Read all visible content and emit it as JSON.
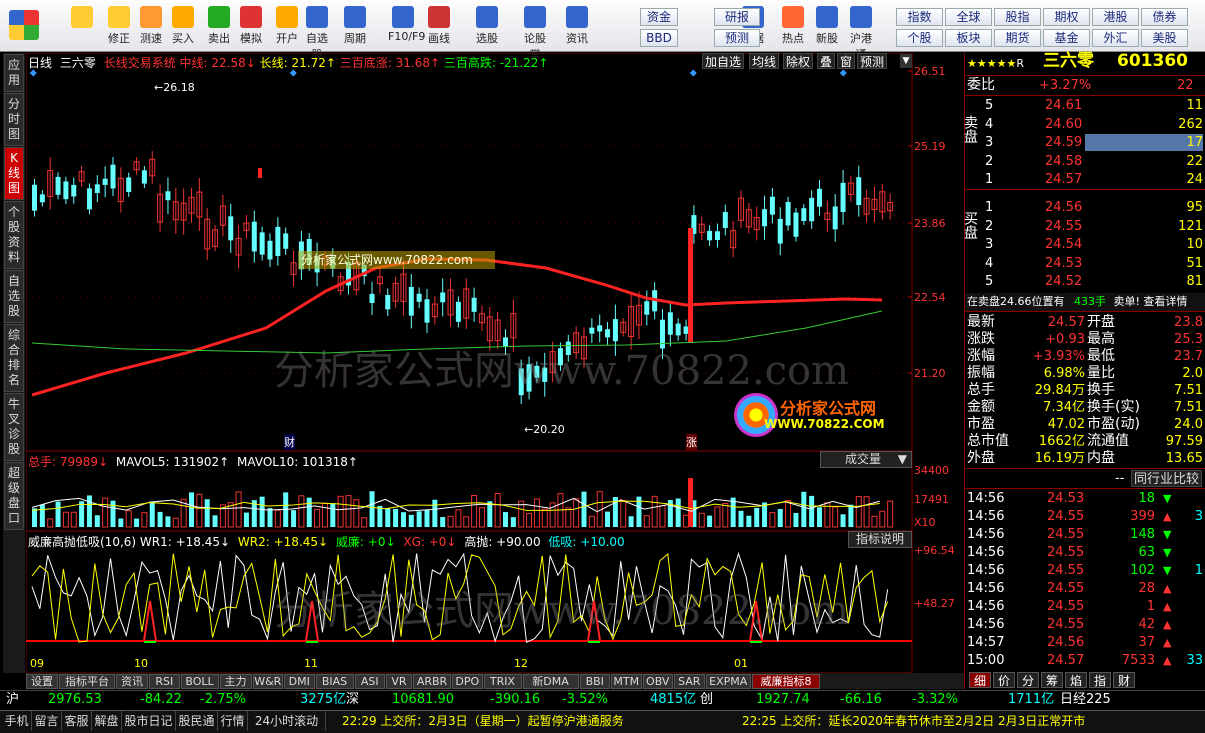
{
  "toolbar": {
    "left": [
      {
        "label": "",
        "icon": "grid-app-icon"
      },
      {
        "label": "",
        "icon": "back-arrow-icon"
      },
      {
        "label": "修正",
        "icon": "restore-icon"
      },
      {
        "label": "测速",
        "icon": "speed-test-icon"
      },
      {
        "label": "买入",
        "icon": "buy-icon"
      },
      {
        "label": "卖出",
        "icon": "sell-icon"
      },
      {
        "label": "模拟",
        "icon": "hammer-icon"
      },
      {
        "label": "开户",
        "icon": "lock-icon"
      },
      {
        "label": "自选股",
        "icon": "favorites-icon"
      },
      {
        "label": "周期",
        "icon": "clock-icon"
      },
      {
        "label": "F10/F9",
        "icon": "f10-icon"
      },
      {
        "label": "画线",
        "icon": "pen-icon"
      },
      {
        "label": "选股",
        "icon": "screener-icon"
      },
      {
        "label": "论股堂",
        "icon": "forum-icon"
      },
      {
        "label": "资讯",
        "icon": "news-icon"
      },
      {
        "label": "数据",
        "icon": "data-icon"
      },
      {
        "label": "热点",
        "icon": "hot-icon"
      },
      {
        "label": "新股",
        "icon": "new-stock-icon"
      },
      {
        "label": "沪港通",
        "icon": "hk-connect-icon"
      }
    ],
    "mid_tags": [
      "资金",
      "BBD",
      "研报",
      "预测"
    ],
    "right_tags": [
      "指数",
      "全球",
      "股指",
      "期权",
      "港股",
      "债券",
      "个股",
      "板块",
      "期货",
      "基金",
      "外汇",
      "美股"
    ]
  },
  "leftbar": [
    "应用",
    "分时图",
    "K线图",
    "个股资料",
    "自选股",
    "综合排名",
    "牛叉诊股",
    "超级盘口"
  ],
  "chart": {
    "period": "日线",
    "stock": "三六零",
    "indicator_name": "长线交易系统",
    "mid": "中线: 22.58↓",
    "long": "长线: 21.72↑",
    "bottom_rise": "三百底涨: 31.68↑",
    "top_fall": "三百高跌: -21.22↑",
    "top_buttons": [
      "加自选",
      "均线",
      "除权",
      "叠",
      "窗",
      "预测"
    ],
    "price_axis": [
      "26.51",
      "25.19",
      "23.86",
      "22.54",
      "21.20"
    ],
    "high_label": "26.18",
    "low_label": "20.20",
    "cai_label": "财",
    "zhang_label": "涨",
    "watermark": "分析家公式网www.70822.com",
    "logo_text": "分析家公式网",
    "logo_url": "WWW.70822.COM",
    "vol_title": "总手: 79989↓",
    "mavol5": "MAVOL5: 131902↑",
    "mavol10": "MAVOL10: 101318↑",
    "vol_select": "成交量",
    "vol_axis": [
      "34400",
      "17491",
      "X10"
    ],
    "ind_title": "威廉高抛低吸(10,6)",
    "wr1": "WR1: +18.45↓",
    "wr2": "WR2: +18.45↓",
    "wl": "威廉: +0↓",
    "xg": "XG: +0↓",
    "gp": "高抛: +90.00",
    "dx": "低吸: +10.00",
    "ind_btn": "指标说明",
    "ind_axis": [
      "+96.54",
      "+48.27"
    ],
    "date_axis": [
      "09",
      "10",
      "11",
      "12",
      "01"
    ]
  },
  "bottom_tabs": [
    "设置",
    "指标平台",
    "资讯",
    "RSI",
    "BOLL",
    "主力",
    "W&R",
    "DMI",
    "BIAS",
    "ASI",
    "VR",
    "ARBR",
    "DPO",
    "TRIX",
    "新DMA",
    "BBI",
    "MTM",
    "OBV",
    "SAR",
    "EXPMA",
    "威廉指标8"
  ],
  "right": {
    "stars": "★★★★★",
    "r": "R",
    "name": "三六零",
    "code": "601360",
    "webi_label": "委比",
    "webi": "+3.27%",
    "webi_val": "22",
    "sell_label": "卖盘",
    "buy_label": "买盘",
    "sell": [
      {
        "n": "5",
        "p": "24.61",
        "v": "11"
      },
      {
        "n": "4",
        "p": "24.60",
        "v": "262"
      },
      {
        "n": "3",
        "p": "24.59",
        "v": "17"
      },
      {
        "n": "2",
        "p": "24.58",
        "v": "22"
      },
      {
        "n": "1",
        "p": "24.57",
        "v": "24"
      }
    ],
    "buy": [
      {
        "n": "1",
        "p": "24.56",
        "v": "95"
      },
      {
        "n": "2",
        "p": "24.55",
        "v": "121"
      },
      {
        "n": "3",
        "p": "24.54",
        "v": "10"
      },
      {
        "n": "4",
        "p": "24.53",
        "v": "51"
      },
      {
        "n": "5",
        "p": "24.52",
        "v": "81"
      }
    ],
    "sellline": "在卖盘24.66位置有",
    "sellline_v": "433手",
    "sellline_b": "卖单!",
    "sellline_c": "查看详情",
    "stats": [
      {
        "l1": "最新",
        "v1": "24.57",
        "l2": "开盘",
        "v2": "23.8"
      },
      {
        "l1": "涨跌",
        "v1": "+0.93",
        "l2": "最高",
        "v2": "25.3"
      },
      {
        "l1": "涨幅",
        "v1": "+3.93%",
        "l2": "最低",
        "v2": "23.7"
      },
      {
        "l1": "振幅",
        "v1": "6.98%",
        "l2": "量比",
        "v2": "2.0"
      },
      {
        "l1": "总手",
        "v1": "29.84万",
        "l2": "换手",
        "v2": "7.51"
      },
      {
        "l1": "金额",
        "v1": "7.34亿",
        "l2": "换手(实)",
        "v2": "7.51"
      },
      {
        "l1": "市盈",
        "v1": "47.02",
        "l2": "市盈(动)",
        "v2": "24.0"
      },
      {
        "l1": "总市值",
        "v1": "1662亿",
        "l2": "流通值",
        "v2": "97.59"
      },
      {
        "l1": "外盘",
        "v1": "16.19万",
        "l2": "内盘",
        "v2": "13.65"
      }
    ],
    "dash": "--",
    "peer": "同行业比较",
    "trades": [
      {
        "t": "14:56",
        "p": "24.53",
        "v": "18",
        "d": "down",
        "x": ""
      },
      {
        "t": "14:56",
        "p": "24.55",
        "v": "399",
        "d": "up",
        "x": "3"
      },
      {
        "t": "14:56",
        "p": "24.55",
        "v": "148",
        "d": "down",
        "x": ""
      },
      {
        "t": "14:56",
        "p": "24.55",
        "v": "63",
        "d": "down",
        "x": ""
      },
      {
        "t": "14:56",
        "p": "24.55",
        "v": "102",
        "d": "down",
        "x": "1"
      },
      {
        "t": "14:56",
        "p": "24.55",
        "v": "28",
        "d": "up",
        "x": ""
      },
      {
        "t": "14:56",
        "p": "24.55",
        "v": "1",
        "d": "up",
        "x": ""
      },
      {
        "t": "14:56",
        "p": "24.55",
        "v": "42",
        "d": "up",
        "x": ""
      },
      {
        "t": "14:57",
        "p": "24.56",
        "v": "37",
        "d": "up",
        "x": ""
      },
      {
        "t": "15:00",
        "p": "24.57",
        "v": "7533",
        "d": "up",
        "x": "33"
      }
    ],
    "tabs": [
      "细",
      "价",
      "分",
      "筹",
      "焰",
      "指",
      "财"
    ]
  },
  "index": {
    "sh": "沪",
    "sh_v": "2976.53",
    "sh_c": "-84.22",
    "sh_p": "-2.75%",
    "sh_a": "3275亿",
    "sz": "深",
    "sz_v": "10681.90",
    "sz_c": "-390.16",
    "sz_p": "-3.52%",
    "sz_a": "4815亿",
    "cy": "创",
    "cy_v": "1927.74",
    "cy_c": "-66.16",
    "cy_p": "-3.32%",
    "cy_a": "1711亿",
    "rt": "日经225"
  },
  "ticker": {
    "tabs": [
      "手机",
      "留言",
      "客服",
      "解盘",
      "股市日记",
      "股民通",
      "行情",
      "24小时滚动"
    ],
    "news1": "22:29 上交所：2月3日（星期一）起暂停沪港通服务",
    "news2": "22:25 上交所：延长2020年春节休市至2月2日 2月3日正常开市"
  }
}
